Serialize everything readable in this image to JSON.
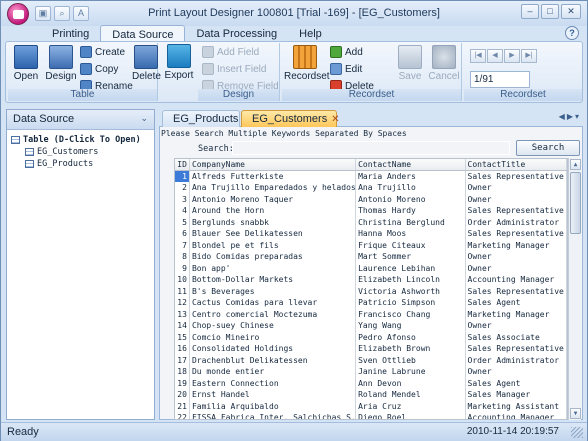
{
  "window": {
    "title": "Print Layout Designer 100801 [Trial -169] - [EG_Customers]"
  },
  "ribbon_tabs": [
    {
      "label": "Printing"
    },
    {
      "label": "Data Source"
    },
    {
      "label": "Data Processing"
    },
    {
      "label": "Help"
    }
  ],
  "ribbon": {
    "table": {
      "label": "Table",
      "open": "Open",
      "design": "Design",
      "create": "Create",
      "copy": "Copy",
      "rename": "Rename",
      "delete": "Delete",
      "export": "Export"
    },
    "design": {
      "label": "Design",
      "add_field": "Add Field",
      "insert_field": "Insert Field",
      "remove_field": "Remove Field"
    },
    "recordset": {
      "label": "Recordset",
      "recordset": "Recordset",
      "add": "Add",
      "edit": "Edit",
      "delete": "Delete",
      "save": "Save",
      "cancel": "Cancel"
    },
    "recordset_nav": {
      "label": "Recordset",
      "position": "1/91"
    }
  },
  "left_panel": {
    "title": "Data Source",
    "root": "Table (D-Click To Open)",
    "tables": [
      "EG_Customers",
      "EG_Products"
    ]
  },
  "doc_tabs": [
    {
      "label": "EG_Products"
    },
    {
      "label": "EG_Customers"
    }
  ],
  "grid": {
    "hint": "Please Search Multiple Keywords Separated By Spaces",
    "search_label": "Search:",
    "search_value": "",
    "search_button": "Search",
    "columns": [
      "ID",
      "CompanyName",
      "ContactName",
      "ContactTitle"
    ],
    "rows": [
      [
        "1",
        "Alfreds Futterkiste",
        "Maria Anders",
        "Sales Representative"
      ],
      [
        "2",
        "Ana Trujillo Emparedados y helados",
        "Ana Trujillo",
        "Owner"
      ],
      [
        "3",
        "Antonio Moreno Taquer",
        "Antonio Moreno",
        "Owner"
      ],
      [
        "4",
        "Around the Horn",
        "Thomas Hardy",
        "Sales Representative"
      ],
      [
        "5",
        "Berglunds snabbk",
        "Christina Berglund",
        "Order Administrator"
      ],
      [
        "6",
        "Blauer See Delikatessen",
        "Hanna Moos",
        "Sales Representative"
      ],
      [
        "7",
        "Blondel pe et fils",
        "Frique Citeaux",
        "Marketing Manager"
      ],
      [
        "8",
        "Bido Comidas preparadas",
        "Mart Sommer",
        "Owner"
      ],
      [
        "9",
        "Bon app'",
        "Laurence Lebihan",
        "Owner"
      ],
      [
        "10",
        "Bottom-Dollar Markets",
        "Elizabeth Lincoln",
        "Accounting Manager"
      ],
      [
        "11",
        "B's Beverages",
        "Victoria Ashworth",
        "Sales Representative"
      ],
      [
        "12",
        "Cactus Comidas para llevar",
        "Patricio Simpson",
        "Sales Agent"
      ],
      [
        "13",
        "Centro comercial Moctezuma",
        "Francisco Chang",
        "Marketing Manager"
      ],
      [
        "14",
        "Chop-suey Chinese",
        "Yang Wang",
        "Owner"
      ],
      [
        "15",
        "Comcio Mineiro",
        "Pedro Afonso",
        "Sales Associate"
      ],
      [
        "16",
        "Consolidated Holdings",
        "Elizabeth Brown",
        "Sales Representative"
      ],
      [
        "17",
        "Drachenblut Delikatessen",
        "Sven Ottlieb",
        "Order Administrator"
      ],
      [
        "18",
        "Du monde entier",
        "Janine Labrune",
        "Owner"
      ],
      [
        "19",
        "Eastern Connection",
        "Ann Devon",
        "Sales Agent"
      ],
      [
        "20",
        "Ernst Handel",
        "Roland Mendel",
        "Sales Manager"
      ],
      [
        "21",
        "Familia Arquibaldo",
        "Aria Cruz",
        "Marketing Assistant"
      ],
      [
        "22",
        "FISSA Fabrica Inter. Salchichas S.A.",
        "Diego Roel",
        "Accounting Manager"
      ]
    ]
  },
  "status": {
    "text": "Ready",
    "datetime": "2010-11-14 20:19:57"
  }
}
